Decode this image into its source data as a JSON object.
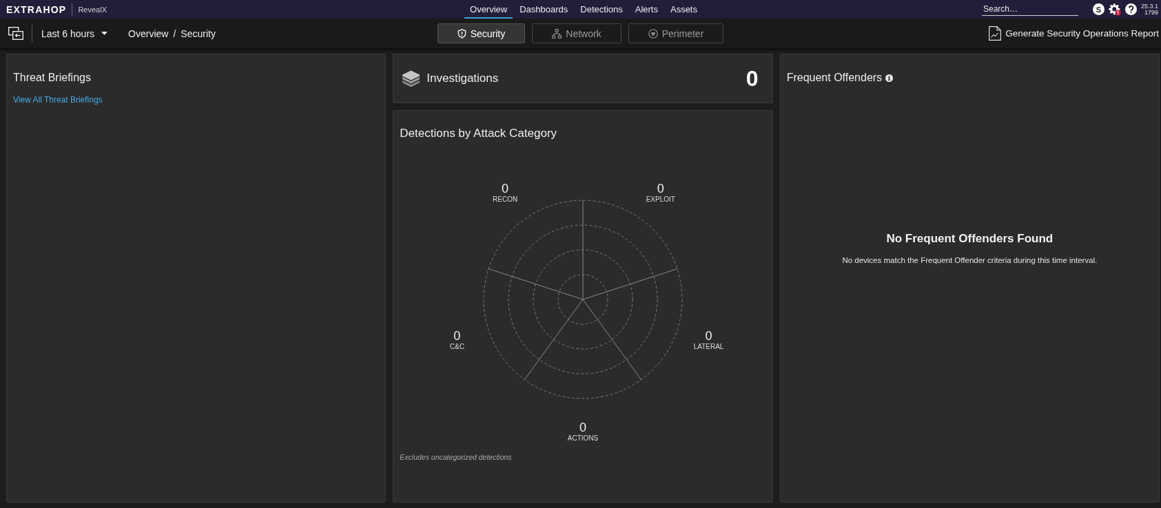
{
  "top_nav": {
    "logo": "EXTRAHOP",
    "product": "RevealX",
    "items": [
      {
        "label": "Overview",
        "selected": true
      },
      {
        "label": "Dashboards",
        "selected": false
      },
      {
        "label": "Detections",
        "selected": false
      },
      {
        "label": "Alerts",
        "selected": false
      },
      {
        "label": "Assets",
        "selected": false
      }
    ],
    "search": {
      "placeholder": "Search…"
    },
    "user_initial": "S",
    "version": "25.3.1",
    "build": "1799"
  },
  "toolbar": {
    "time_range": "Last 6 hours",
    "breadcrumb": [
      "Overview",
      "Security"
    ],
    "breadcrumb_separator": "/",
    "views": [
      {
        "label": "Security",
        "selected": true
      },
      {
        "label": "Network",
        "selected": false
      },
      {
        "label": "Perimeter",
        "selected": false
      }
    ],
    "report_button": "Generate Security Operations Report"
  },
  "threat_briefings": {
    "title": "Threat Briefings",
    "link": "View All Threat Briefings"
  },
  "investigations": {
    "title": "Investigations",
    "count": "0"
  },
  "detections": {
    "title": "Detections by Attack Category",
    "categories": [
      {
        "name": "RECON",
        "count": "0"
      },
      {
        "name": "EXPLOIT",
        "count": "0"
      },
      {
        "name": "LATERAL",
        "count": "0"
      },
      {
        "name": "ACTIONS",
        "count": "0"
      },
      {
        "name": "C&C",
        "count": "0"
      }
    ],
    "footnote": "Excludes uncategorized detections"
  },
  "frequent_offenders": {
    "title": "Frequent Offenders",
    "empty_title": "No Frequent Offenders Found",
    "empty_message": "No devices match the Frequent Offender criteria during this time interval."
  }
}
